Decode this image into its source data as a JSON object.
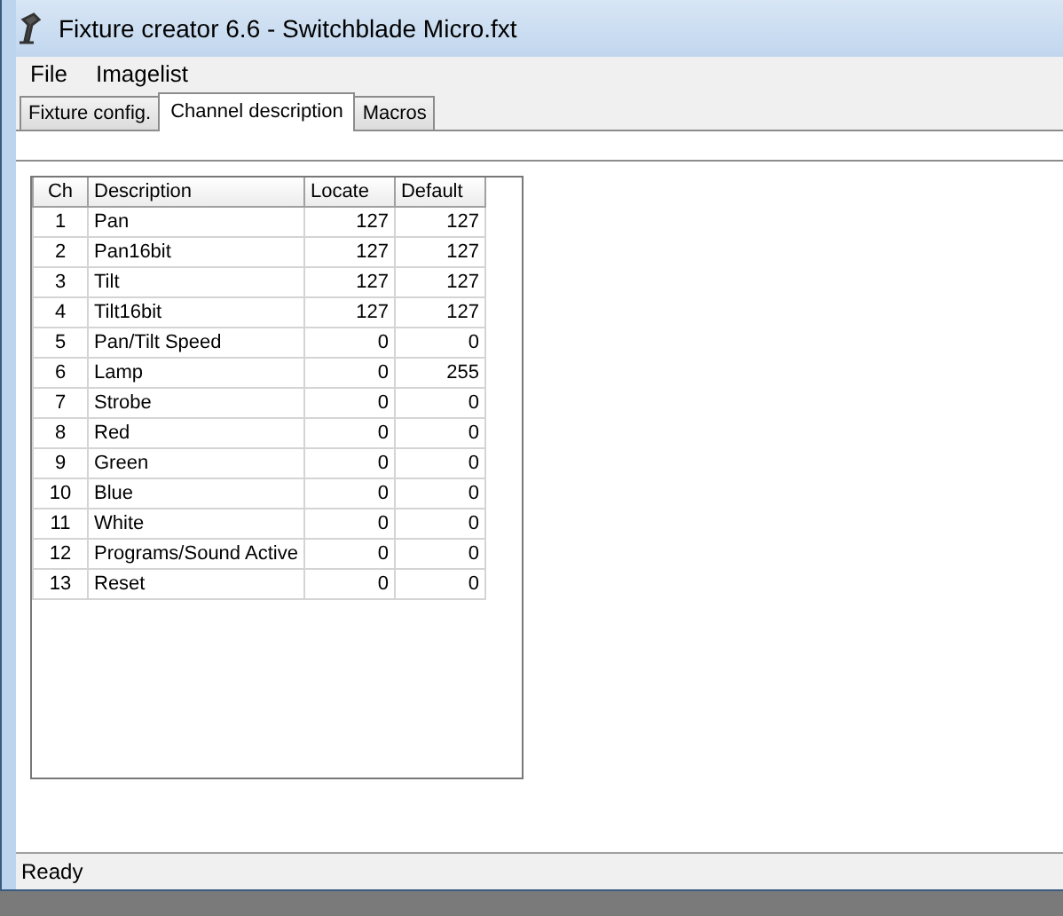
{
  "window": {
    "title": "Fixture creator 6.6 - Switchblade Micro.fxt"
  },
  "menu": [
    "File",
    "Imagelist"
  ],
  "tabs": [
    {
      "label": "Fixture config.",
      "selected": false
    },
    {
      "label": "Channel description",
      "selected": true
    },
    {
      "label": "Macros",
      "selected": false
    }
  ],
  "table": {
    "columns": [
      "Ch",
      "Description",
      "Locate",
      "Default"
    ],
    "rows": [
      [
        "1",
        "Pan",
        "127",
        "127"
      ],
      [
        "2",
        "Pan16bit",
        "127",
        "127"
      ],
      [
        "3",
        "Tilt",
        "127",
        "127"
      ],
      [
        "4",
        "Tilt16bit",
        "127",
        "127"
      ],
      [
        "5",
        "Pan/Tilt Speed",
        "0",
        "0"
      ],
      [
        "6",
        "Lamp",
        "0",
        "255"
      ],
      [
        "7",
        "Strobe",
        "0",
        "0"
      ],
      [
        "8",
        "Red",
        "0",
        "0"
      ],
      [
        "9",
        "Green",
        "0",
        "0"
      ],
      [
        "10",
        "Blue",
        "0",
        "0"
      ],
      [
        "11",
        "White",
        "0",
        "0"
      ],
      [
        "12",
        "Programs/Sound Active",
        "0",
        "0"
      ],
      [
        "13",
        "Reset",
        "0",
        "0"
      ]
    ]
  },
  "status_bar": "Ready"
}
